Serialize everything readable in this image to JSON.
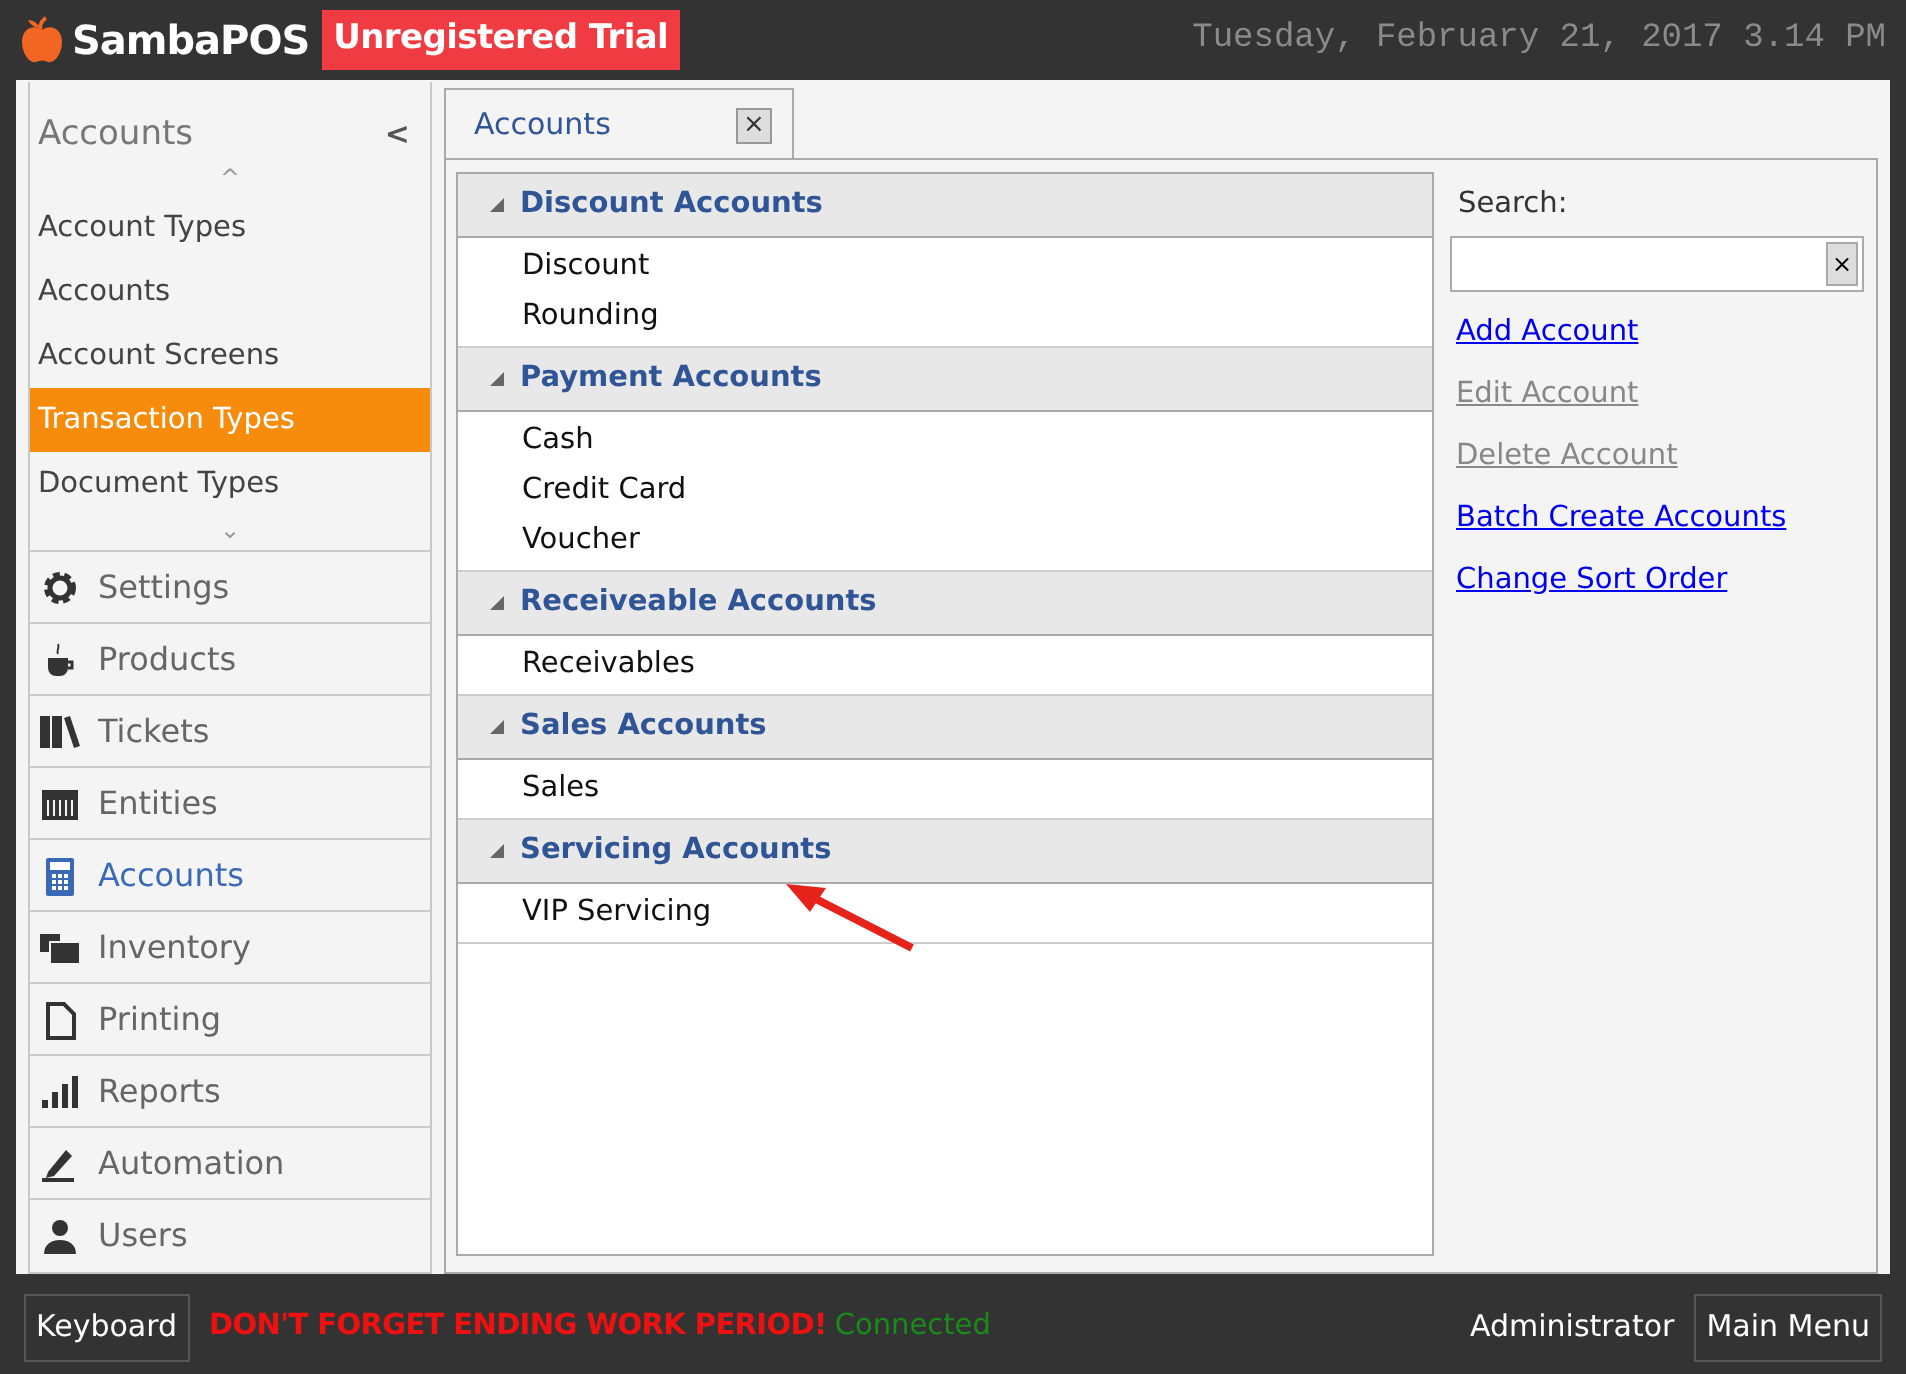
{
  "header": {
    "app_name": "SambaPOS",
    "badge": "Unregistered Trial",
    "datetime": "Tuesday, February 21, 2017 3.14 PM"
  },
  "sidebar": {
    "title": "Accounts",
    "collapse": "<",
    "scroll_up": "^",
    "scroll_down": "⌄",
    "items": [
      {
        "label": "Account Types",
        "selected": false
      },
      {
        "label": "Accounts",
        "selected": false
      },
      {
        "label": "Account Screens",
        "selected": false
      },
      {
        "label": "Transaction Types",
        "selected": true
      },
      {
        "label": "Document Types",
        "selected": false
      }
    ],
    "modules": [
      {
        "label": "Settings",
        "kind": "gear",
        "selected": false
      },
      {
        "label": "Products",
        "kind": "cup",
        "selected": false
      },
      {
        "label": "Tickets",
        "kind": "books",
        "selected": false
      },
      {
        "label": "Entities",
        "kind": "grid",
        "selected": false
      },
      {
        "label": "Accounts",
        "kind": "calculator",
        "selected": true
      },
      {
        "label": "Inventory",
        "kind": "boxes",
        "selected": false
      },
      {
        "label": "Printing",
        "kind": "page",
        "selected": false
      },
      {
        "label": "Reports",
        "kind": "bars",
        "selected": false
      },
      {
        "label": "Automation",
        "kind": "pen",
        "selected": false
      },
      {
        "label": "Users",
        "kind": "user",
        "selected": false
      }
    ]
  },
  "tabs": [
    {
      "label": "Accounts",
      "close": "×",
      "selected": true
    }
  ],
  "account_groups": [
    {
      "name": "Discount Accounts",
      "expanded": true,
      "items": [
        "Discount",
        "Rounding"
      ]
    },
    {
      "name": "Payment Accounts",
      "expanded": true,
      "items": [
        "Cash",
        "Credit Card",
        "Voucher"
      ]
    },
    {
      "name": "Receiveable Accounts",
      "expanded": true,
      "items": [
        "Receivables"
      ]
    },
    {
      "name": "Sales Accounts",
      "expanded": true,
      "items": [
        "Sales"
      ]
    },
    {
      "name": "Servicing Accounts",
      "expanded": true,
      "items": [
        "VIP Servicing"
      ]
    }
  ],
  "search": {
    "label": "Search:",
    "clear": "×"
  },
  "actions": [
    {
      "label": "Add Account",
      "disabled": false
    },
    {
      "label": "Edit Account",
      "disabled": true
    },
    {
      "label": "Delete Account",
      "disabled": true
    },
    {
      "label": "Batch Create Accounts",
      "disabled": false
    },
    {
      "label": "Change Sort Order",
      "disabled": false
    }
  ],
  "status_bar": {
    "keyboard": "Keyboard",
    "warning": "DON'T FORGET ENDING WORK PERIOD!",
    "connection": "Connected",
    "user": "Administrator",
    "main_menu": "Main Menu"
  }
}
